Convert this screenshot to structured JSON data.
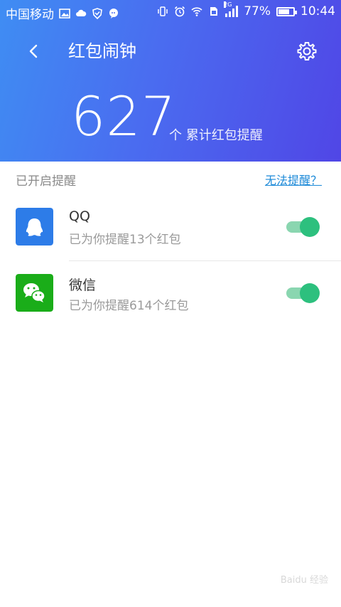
{
  "status_bar": {
    "carrier": "中国移动",
    "network_tag": "2G",
    "battery": "77%",
    "battery_level": 0.77,
    "time": "10:44",
    "left_icons": [
      "gallery-icon",
      "cloud-icon",
      "shield-icon",
      "chat-bubble-icon"
    ],
    "right_icons": [
      "vibrate-icon",
      "alarm-icon",
      "wifi-icon",
      "sim-icon",
      "signal-icon",
      "battery-icon"
    ]
  },
  "toolbar": {
    "title": "红包闹钟",
    "back_icon": "back-arrow-icon",
    "settings_icon": "gear-icon"
  },
  "stats": {
    "count": "627",
    "unit": "个 累计红包提醒"
  },
  "section": {
    "label": "已开启提醒",
    "help_link": "无法提醒？"
  },
  "apps": [
    {
      "name": "QQ",
      "subtitle": "已为你提醒13个红包",
      "enabled": true,
      "icon": "qq-icon",
      "color": "#2d7ce8"
    },
    {
      "name": "微信",
      "subtitle": "已为你提醒614个红包",
      "enabled": true,
      "icon": "wechat-icon",
      "color": "#1aad19"
    }
  ],
  "colors": {
    "header_start": "#3f8df3",
    "header_end": "#5046e6",
    "toggle_on": "#2dc07e",
    "link": "#1d8ad8"
  },
  "watermark": "Baidu 经验"
}
